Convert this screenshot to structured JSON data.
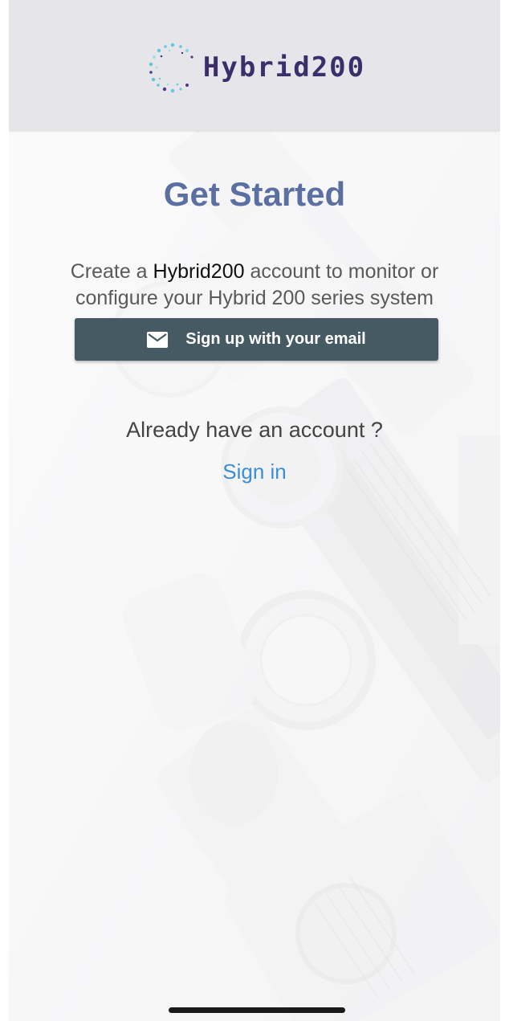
{
  "header": {
    "logo_text": "Hybrid200"
  },
  "main": {
    "title": "Get Started",
    "description_prefix": "Create a ",
    "description_brand": "Hybrid200",
    "description_suffix": " account to monitor or",
    "description_line2": "configure your Hybrid 200 series system",
    "signup_label": "Sign up with your email",
    "signup_icon": "mail-icon",
    "already_text": "Already have an account ?",
    "signin_label": "Sign in"
  },
  "colors": {
    "header_bg": "#e6e5ea",
    "title": "#5b6fa3",
    "button_bg": "#465a64",
    "link": "#3a8fd4",
    "logo_text": "#3a2f6b"
  }
}
